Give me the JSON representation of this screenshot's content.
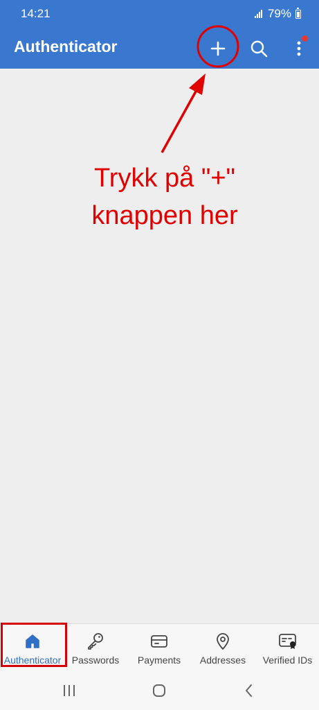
{
  "status_bar": {
    "time": "14:21",
    "battery": "79%"
  },
  "app_bar": {
    "title": "Authenticator",
    "icons": [
      "add-icon",
      "search-icon",
      "more-vert-icon"
    ],
    "background_color": "#3a78d0",
    "notification_dot_color": "#e53935"
  },
  "annotation": {
    "line1": "Trykk på \"+\"",
    "line2": "knappen her",
    "color": "#e00000"
  },
  "bottom_nav": {
    "active_color": "#2f6fc6",
    "items": [
      {
        "label": "Authenticator",
        "icon": "home-icon",
        "active": true
      },
      {
        "label": "Passwords",
        "icon": "key-icon",
        "active": false
      },
      {
        "label": "Payments",
        "icon": "card-icon",
        "active": false
      },
      {
        "label": "Addresses",
        "icon": "location-pin-icon",
        "active": false
      },
      {
        "label": "Verified IDs",
        "icon": "id-card-icon",
        "active": false
      }
    ]
  },
  "system_nav": {
    "icons": [
      "recents-icon",
      "home-circle-icon",
      "back-icon"
    ]
  }
}
